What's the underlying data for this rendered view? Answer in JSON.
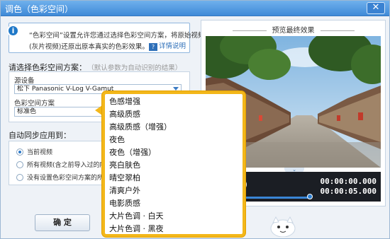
{
  "window": {
    "title": "调色（色彩空间）",
    "close_label": "✕"
  },
  "info": {
    "line1": "“色彩空间”设置允许您通过选择色彩空间方案，将原始视频",
    "line2": "(灰片视频)还原出原本真实的色彩效果。",
    "help_link": "详情说明",
    "help_icon_text": "?"
  },
  "scheme_section": {
    "title": "请选择色彩空间方案：",
    "hint": "（默认参数为自动识别的结果）",
    "source_device_label": "源设备",
    "source_device_value": "松下 Panasonic V-Log V-Gamut",
    "color_scheme_label": "色彩空间方案",
    "color_scheme_value": "标准色"
  },
  "sync_section": {
    "title": "自动同步应用到：",
    "options": [
      {
        "label": "当前视频",
        "selected": true
      },
      {
        "label": "所有视频(含之前导入过的所有",
        "selected": false
      },
      {
        "label": "没有设置色彩空间方案的所有",
        "selected": false
      }
    ]
  },
  "ok_button": "确  定",
  "preview": {
    "title": "预览最终效果",
    "current_time": "00:00:00.000",
    "total_time": "00:00:05.000",
    "progress": 1.0
  },
  "dropdown": {
    "options": [
      "色感增强",
      "高级质感",
      "高级质感（增强）",
      "夜色",
      "夜色（增强）",
      "亮白肤色",
      "晴空翠柏",
      "清爽户外",
      "电影质感",
      "大片色调 · 白天",
      "大片色调 · 黑夜"
    ],
    "border_color": "#f3b71a"
  }
}
